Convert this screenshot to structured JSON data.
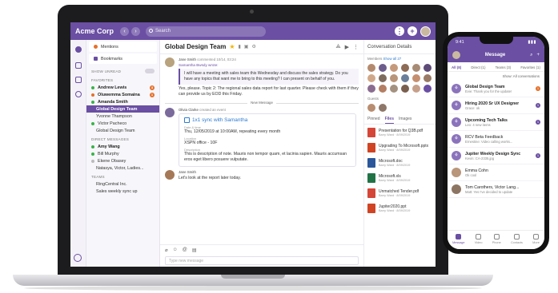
{
  "app": {
    "brand": "Acme Corp",
    "search_placeholder": "Search"
  },
  "sidebar": {
    "mentions": "Mentions",
    "bookmarks": "Bookmarks",
    "show_unread": "SHOW UNREAD",
    "favorites_label": "FAVORITES",
    "favorites": [
      {
        "name": "Andrew Lewis",
        "count": "3"
      },
      {
        "name": "Oluwemma Somaina",
        "count": "1"
      },
      {
        "name": "Amanda Smith",
        "count": ""
      },
      {
        "name": "Global Design Team",
        "count": ""
      },
      {
        "name": "Yvonne Thampson",
        "count": ""
      },
      {
        "name": "Victor Pacheco",
        "count": ""
      },
      {
        "name": "Global Design Team",
        "count": ""
      }
    ],
    "direct_label": "DIRECT MESSAGES",
    "direct": [
      "Amy Wang",
      "Bill Murphy",
      "Ekene Obasey",
      "Natasya, Victor, Ladies..."
    ],
    "teams_label": "TEAMS",
    "teams": [
      "RingCentral Inc.",
      "Sales weekly sync up"
    ]
  },
  "conversation": {
    "title": "Global Design Team",
    "messages": {
      "m1_author": "Jane Smith",
      "m1_time": "commented 10/14, 03:24",
      "quote_author": "Samantha Bwsdy wrote:",
      "quote_text": "I will have a meeting with sales team this Wednesday and discuss the sales strategy. Do you have any topics that want me to bring to this meeting? I can present on behalf of you.",
      "reply": "Yes, please. Topic 2: The regional sales data report for last quarter. Please check with them if they can provide us by EOD this Friday.",
      "new_message": "New Message",
      "m2_author": "Olivia Clarke",
      "m2_time": "created an event",
      "event_title": "1x1 sync with Samantha",
      "date_label": "Date & time",
      "date_value": "Thu, 12/05/2019 at 10:00AM, repeating every month",
      "location_label": "Location",
      "location_value": "XSPN office - 10F",
      "desc_label": "Description",
      "desc_value": "This is description of note. Mauris non tempor quam, et lacinia sapien. Mauris accumsan eros eget libero posuere vulputate.",
      "m3_author": "Jane Smith",
      "m3_text": "Let's look at the report later today."
    },
    "composer_placeholder": "Type new message"
  },
  "details": {
    "title": "Conversation Details",
    "members_label": "Members",
    "show_all": "Show all 27",
    "guests_label": "Guests",
    "tabs": [
      "Pinned",
      "Files",
      "Images"
    ],
    "files": [
      {
        "name": "Presentation for Q3B.pdf",
        "meta": "Barry Ward · 8/09/2019",
        "color": "#d44638"
      },
      {
        "name": "Upgrading To Microsoft.pptx",
        "meta": "Barry Ward · 8/09/2019",
        "color": "#d04423"
      },
      {
        "name": "Microsoft.doc",
        "meta": "Barry Ward · 8/09/2019",
        "color": "#2b579a"
      },
      {
        "name": "Microsoft.xls",
        "meta": "Barry Ward · 8/09/2019",
        "color": "#217346"
      },
      {
        "name": "Unmatched Tender.pdf",
        "meta": "Barry Ward · 8/09/2019",
        "color": "#d44638"
      },
      {
        "name": "Jupiter2020.ppt",
        "meta": "Barry Ward · 8/09/2019",
        "color": "#d04423"
      }
    ]
  },
  "phone": {
    "time": "9:41",
    "title": "Message",
    "tabs": [
      "All (8)",
      "Direct (1)",
      "Teams (3)",
      "Favorites (1)"
    ],
    "filter": "Show: All conversations",
    "items": [
      {
        "name": "Global Design Team",
        "preview": "Evie: Thank you for the update!",
        "badge": "1"
      },
      {
        "name": "Hiring 2020 Sr UX Designer",
        "preview": "Grace: ok",
        "badge": "1"
      },
      {
        "name": "Upcoming Tech Talks",
        "preview": "Leo: 4 new items",
        "badge": "1"
      },
      {
        "name": "RCV Beta Feedback",
        "preview": "Ernestine: Video calling works...",
        "badge": ""
      },
      {
        "name": "Jupiter Weekly Design Sync",
        "preview": "Kevin: CA-2335.jpg",
        "badge": "1"
      },
      {
        "name": "Emma Cohn",
        "preview": "Ok cool",
        "badge": ""
      },
      {
        "name": "Tom Carothers, Victor Lang...",
        "preview": "Matt: Yes I've decided to update",
        "badge": ""
      }
    ],
    "bottom_nav": [
      "Message",
      "Video",
      "Phone",
      "Contacts",
      "More"
    ]
  },
  "colors": {
    "accent": "#6a4fa3",
    "alert": "#e5702b"
  }
}
